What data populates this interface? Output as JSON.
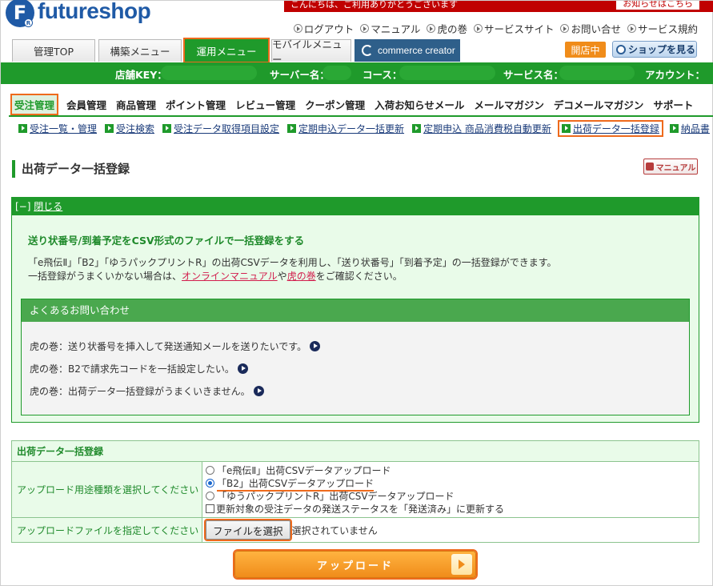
{
  "header": {
    "logo_letter": "F",
    "logo_text": "futureshop",
    "alert_text": "こんにちは、ご利用ありがとうございます",
    "alert_box": "お知らせはこちら",
    "links": [
      "ログアウト",
      "マニュアル",
      "虎の巻",
      "サービスサイト",
      "お問い合せ",
      "サービス規約"
    ]
  },
  "tabs": [
    "管理TOP",
    "構築メニュー",
    "運用メニュー",
    "モバイルメニュー",
    "commerce creator"
  ],
  "status_badge": "開店中",
  "shop_button": "ショップを見る",
  "store_bar": {
    "store_key_label": "店舗KEY：",
    "server_label": "サーバー名：",
    "course_label": "コース：",
    "service_label": "サービス名：",
    "account_label": "アカウント："
  },
  "submenu": [
    "受注管理",
    "会員管理",
    "商品管理",
    "ポイント管理",
    "レビュー管理",
    "クーポン管理",
    "入荷お知らせメール",
    "メールマガジン",
    "デコメールマガジン",
    "サポート"
  ],
  "subnav": [
    "受注一覧・管理",
    "受注検索",
    "受注データ取得項目設定",
    "定期申込データ一括更新",
    "定期申込 商品消費税自動更新",
    "出荷データ一括登録",
    "納品書"
  ],
  "page": {
    "title": "出荷データ一括登録",
    "manual_button": "マニュアル"
  },
  "info": {
    "close_prefix": "[−]",
    "close_label": "閉じる",
    "title": "送り状番号/到着予定をCSV形式のファイルで一括登録をする",
    "line1": "「e飛伝Ⅱ」「B2」「ゆうパックプリントR」の出荷CSVデータを利用し、「送り状番号」「到着予定」の一括登録ができます。",
    "line2_pre": "一括登録がうまくいかない場合は、",
    "line2_link1": "オンラインマニュアル",
    "line2_mid": "や",
    "line2_link2": "虎の巻",
    "line2_post": "をご確認ください。",
    "faq_title": "よくあるお問い合わせ",
    "faq": [
      "虎の巻：送り状番号を挿入して発送通知メールを送りたいです。",
      "虎の巻：B2で請求先コードを一括設定したい。",
      "虎の巻：出荷データ一括登録がうまくいきません。"
    ]
  },
  "form": {
    "title": "出荷データ一括登録",
    "type_label": "アップロード用途種類を選択してください",
    "options": [
      "「e飛伝Ⅱ」出荷CSVデータアップロード",
      "「B2」出荷CSVデータアップロード",
      "「ゆうパックプリントR」出荷CSVデータアップロード"
    ],
    "selected_index": 1,
    "checkbox_label": "更新対象の受注データの発送ステータスを「発送済み」に更新する",
    "file_label": "アップロードファイルを指定してください",
    "file_button": "ファイルを選択",
    "file_status": "選択されていません",
    "upload_button": "アップロード"
  },
  "colors": {
    "brand_green": "#1f9a2b",
    "highlight_orange": "#ee6a1c",
    "logo_blue": "#1f5aa6",
    "link_red": "#d21f4e"
  }
}
